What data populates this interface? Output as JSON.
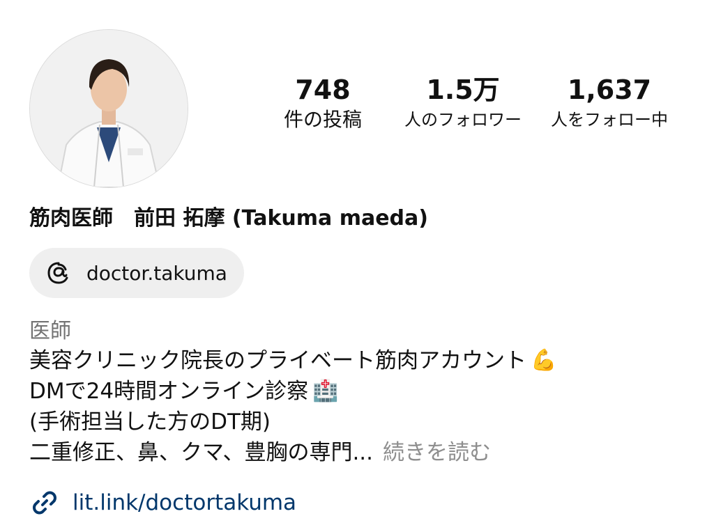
{
  "profile": {
    "stats": {
      "posts_count": "748",
      "posts_label": "件の投稿",
      "followers_count": "1.5万",
      "followers_label": "人のフォロワー",
      "following_count": "1,637",
      "following_label": "人をフォロー中"
    },
    "name": "筋肉医師　前田 拓摩 (Takuma maeda)",
    "threads": {
      "icon": "threads-icon",
      "label": "doctor.takuma"
    },
    "category": "医師",
    "bio": {
      "line1": "美容クリニック院長のプライベート筋肉アカウント",
      "line1_emoji": "💪",
      "line2": "DMで24時間オンライン診察",
      "line2_emoji": "🏥",
      "line3": "(手術担当した方のDT期)",
      "line4": "二重修正、鼻、クマ、豊胸の専門...",
      "more_label": "続きを読む"
    },
    "link": {
      "icon": "link-icon",
      "text": "lit.link/doctortakuma",
      "color": "#00376b"
    }
  }
}
